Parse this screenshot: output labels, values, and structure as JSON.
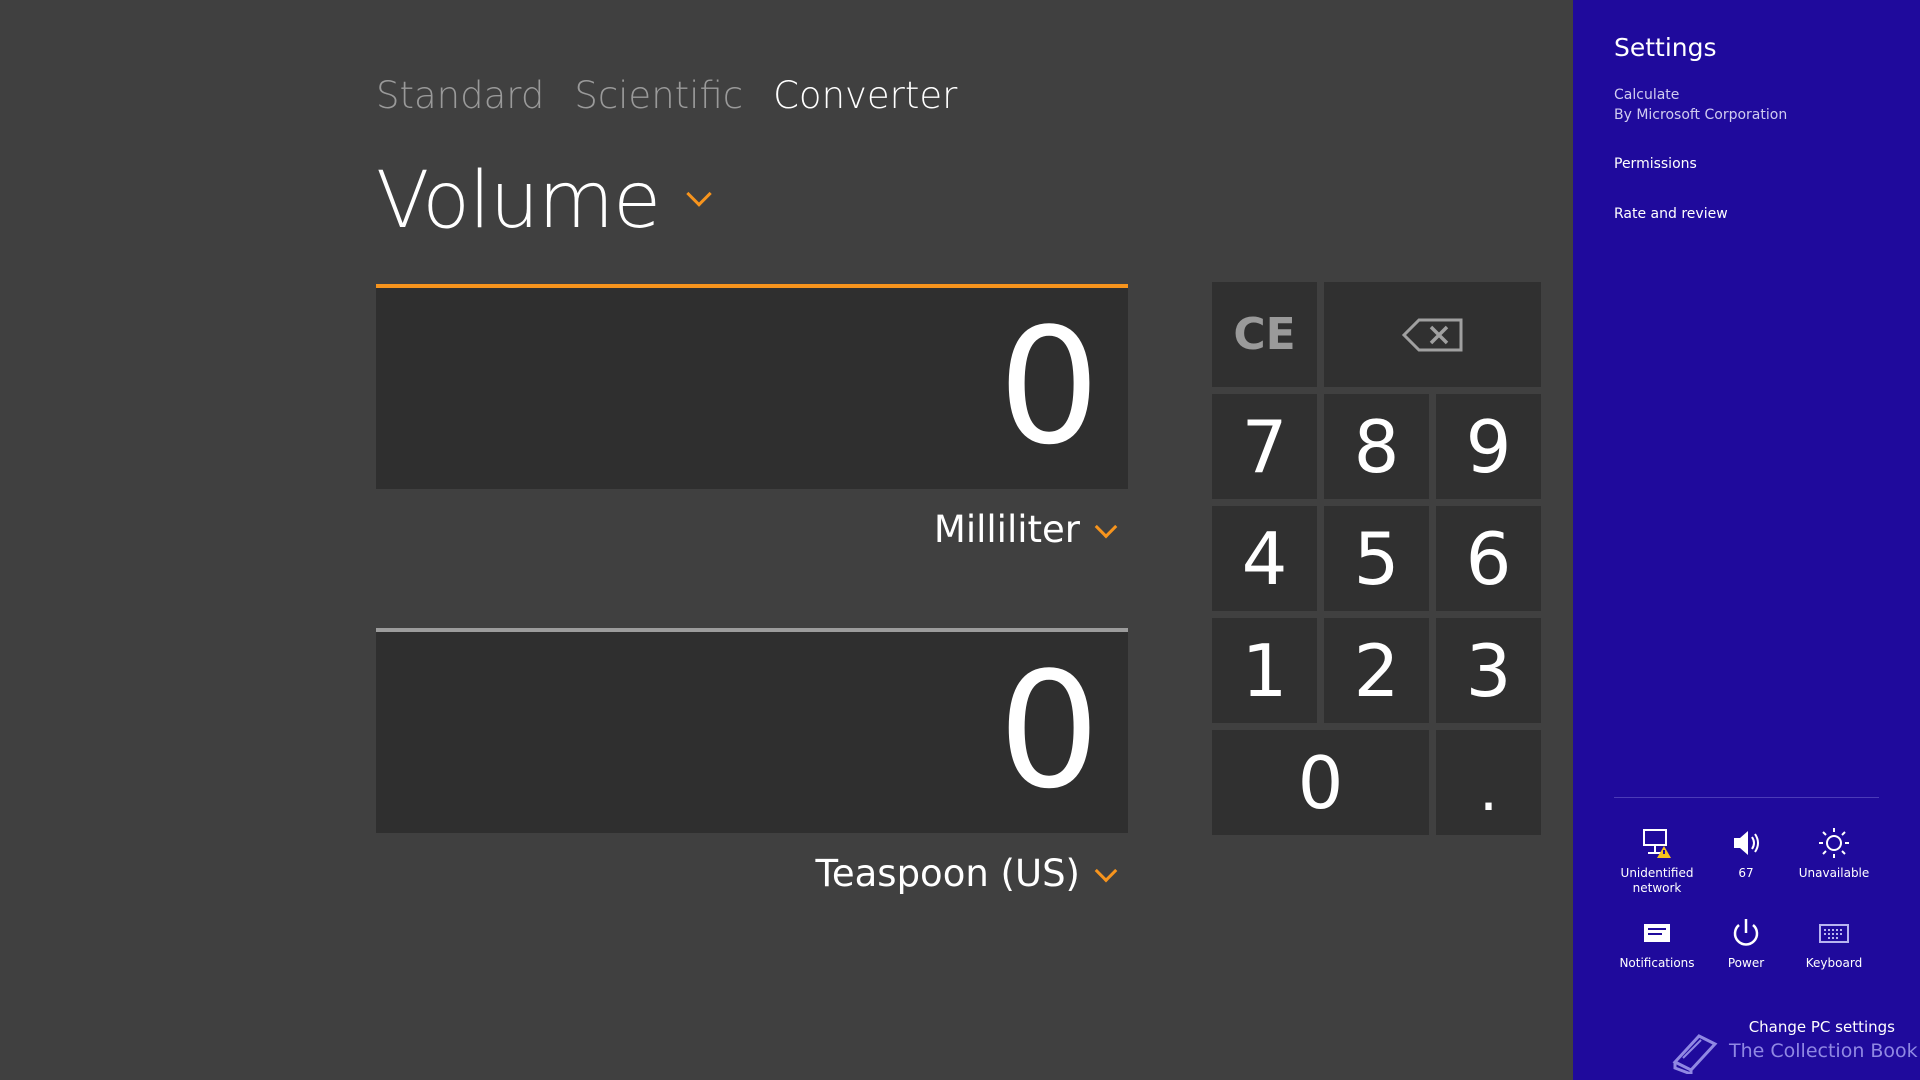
{
  "modes": {
    "standard": "Standard",
    "scientific": "Scientific",
    "converter": "Converter",
    "active": "Converter"
  },
  "category": {
    "label": "Volume"
  },
  "from": {
    "value": "0",
    "unit": "Milliliter"
  },
  "to": {
    "value": "0",
    "unit": "Teaspoon (US)"
  },
  "keypad": {
    "ce": "CE",
    "k7": "7",
    "k8": "8",
    "k9": "9",
    "k4": "4",
    "k5": "5",
    "k6": "6",
    "k1": "1",
    "k2": "2",
    "k3": "3",
    "k0": "0",
    "dot": "."
  },
  "settings": {
    "title": "Settings",
    "app_name": "Calculate",
    "publisher": "By Microsoft Corporation",
    "links": [
      "Permissions",
      "Rate and review"
    ],
    "tiles": {
      "network": {
        "label_line1": "Unidentified",
        "label_line2": "network",
        "icon": "network-warning-icon"
      },
      "volume": {
        "label": "67",
        "icon": "speaker-icon"
      },
      "brightness": {
        "label": "Unavailable",
        "icon": "brightness-icon"
      },
      "notifications": {
        "label": "Notifications",
        "icon": "notifications-icon"
      },
      "power": {
        "label": "Power",
        "icon": "power-icon"
      },
      "keyboard": {
        "label": "Keyboard",
        "icon": "keyboard-icon"
      }
    },
    "change_pc": "Change PC settings"
  },
  "watermark": {
    "text": "The Collection Book",
    "icon": "book-icon"
  },
  "colors": {
    "accent": "#f7941d",
    "charm_bg": "#1f0a9c",
    "app_bg": "#404040",
    "field_bg": "#2f2f2f"
  }
}
